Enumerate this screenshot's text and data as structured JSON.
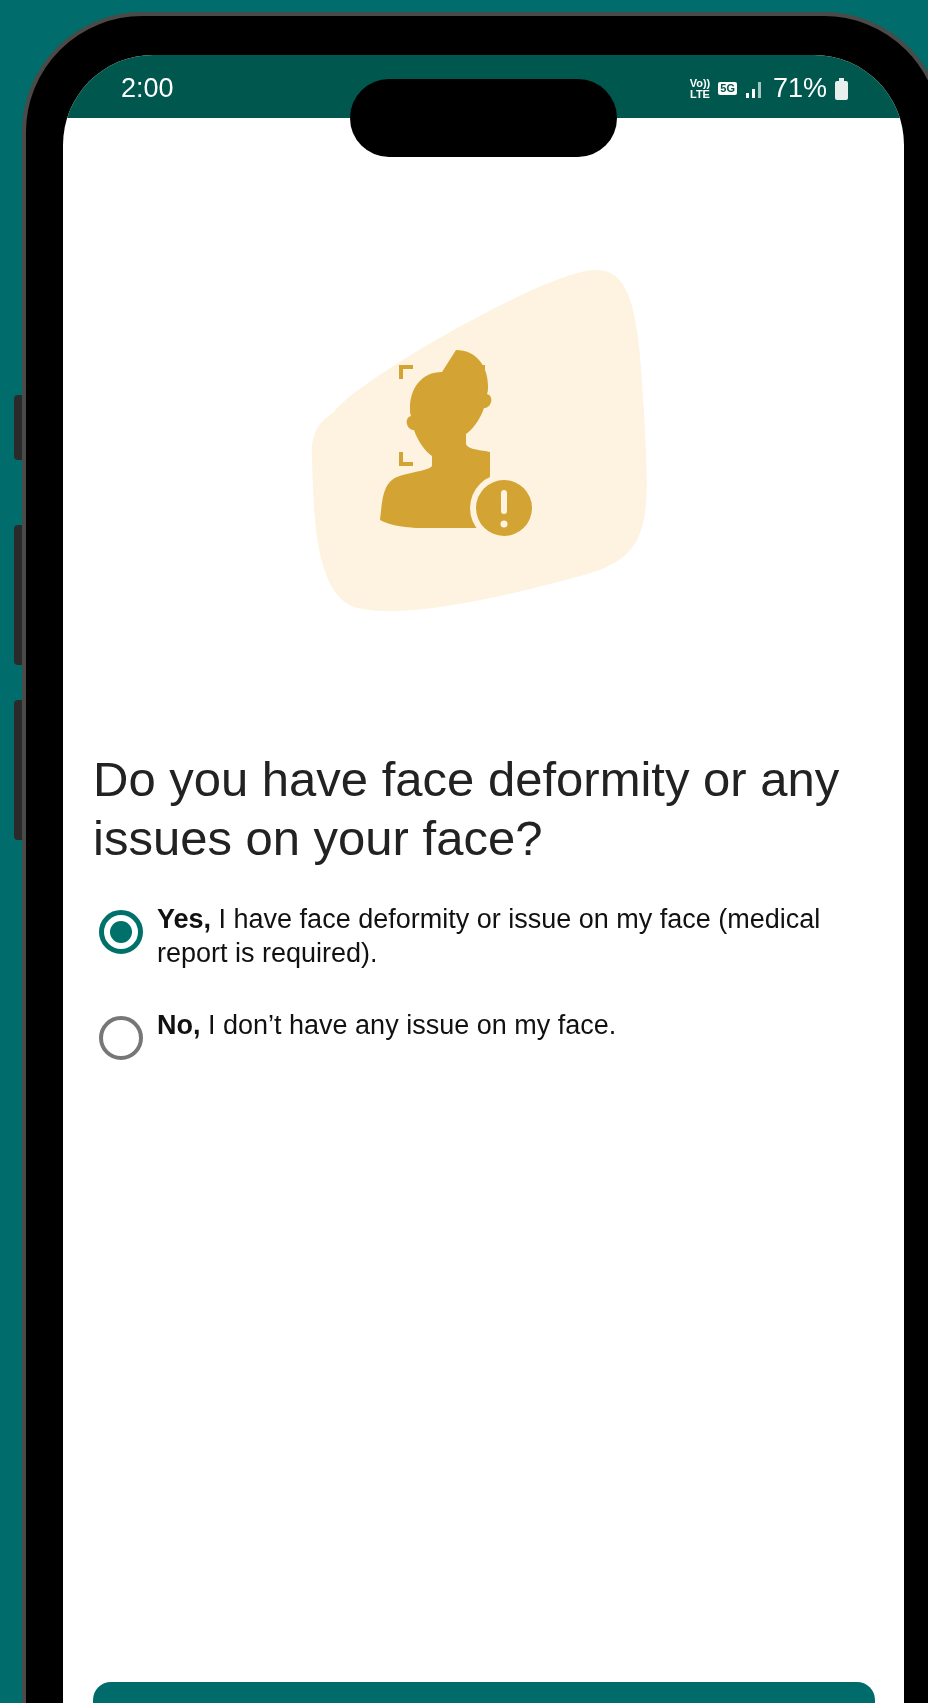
{
  "status_bar": {
    "time": "2:00",
    "volte": [
      "Vo))",
      "LTE"
    ],
    "network": "5G",
    "battery": "71%"
  },
  "question": "Do you have face deformity or any issues on your face?",
  "options": [
    {
      "label": "**Yes,** I have face deformity or issue on my face (medical report is required).",
      "selected": true
    },
    {
      "label": "**No,** I don’t have any issue on my face.",
      "selected": false
    }
  ]
}
